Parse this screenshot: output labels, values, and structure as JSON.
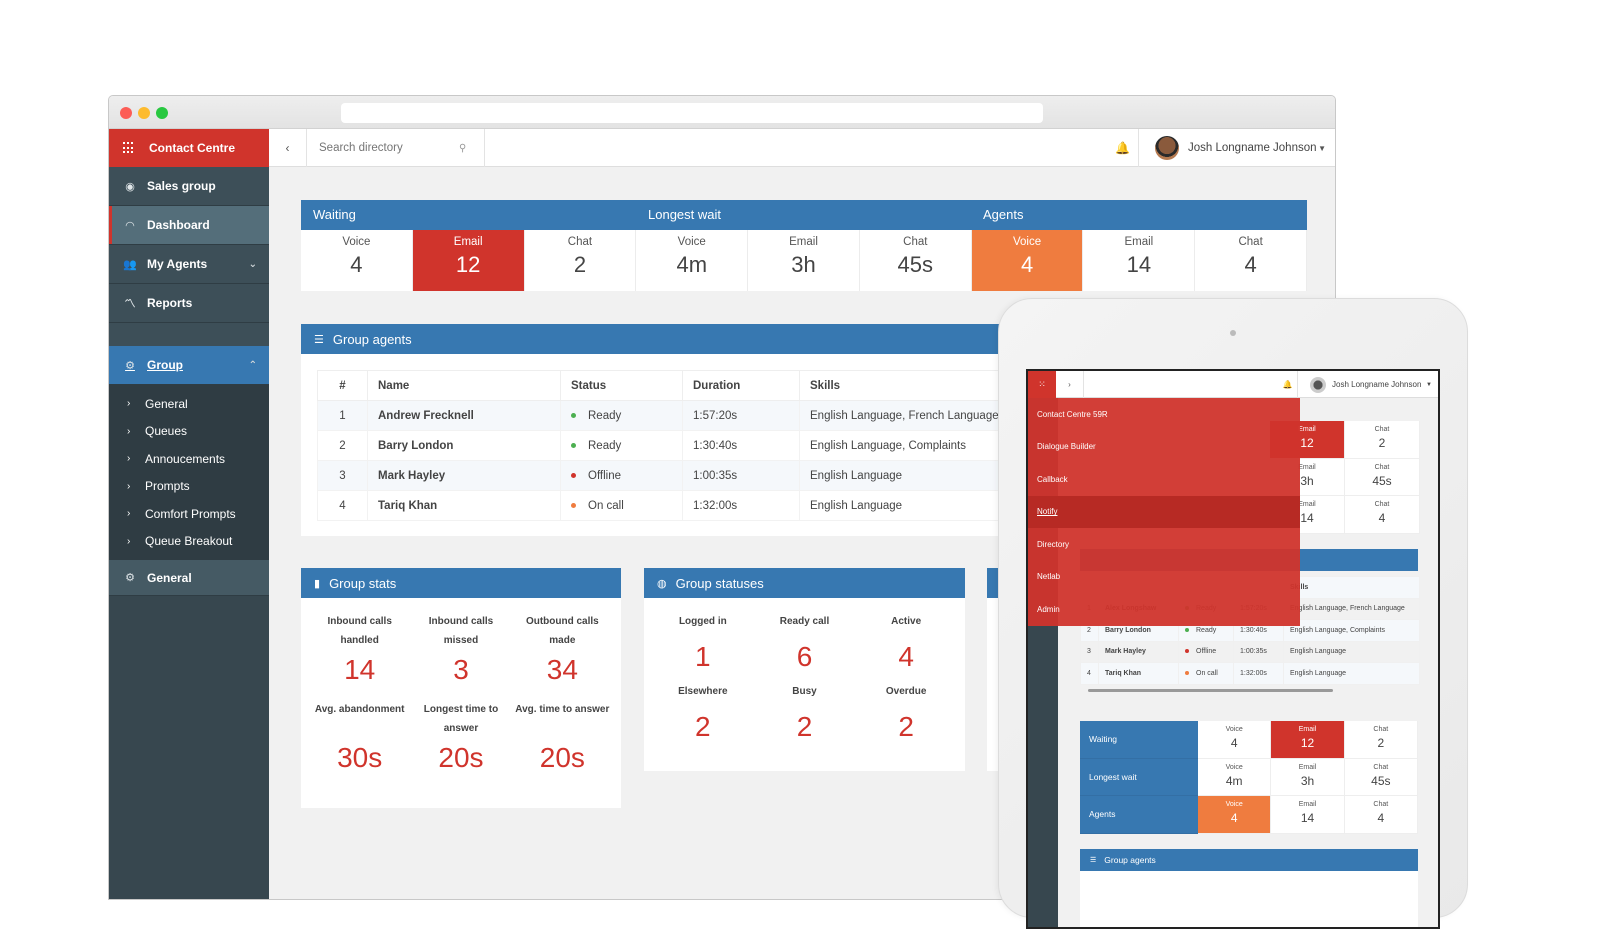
{
  "app": {
    "brand": "Contact Centre",
    "user_name": "Josh Longname Johnson"
  },
  "search": {
    "placeholder": "Search directory"
  },
  "sidebar": {
    "items": [
      {
        "label": "Sales group",
        "icon": "eye-icon"
      },
      {
        "label": "Dashboard",
        "icon": "gauge-icon",
        "active": true
      },
      {
        "label": "My Agents",
        "icon": "users-icon"
      },
      {
        "label": "Reports",
        "icon": "chart-line-icon"
      }
    ],
    "group": {
      "label": "Group",
      "icon": "gear-icon"
    },
    "sub_items": [
      "General",
      "Queues",
      "Annoucements",
      "Prompts",
      "Comfort Prompts",
      "Queue Breakout"
    ],
    "general": {
      "label": "General",
      "icon": "gear-icon"
    }
  },
  "summary": {
    "headers": [
      "Waiting",
      "Longest wait",
      "Agents"
    ],
    "cells": [
      {
        "label": "Voice",
        "value": "4",
        "highlight": ""
      },
      {
        "label": "Email",
        "value": "12",
        "highlight": "red"
      },
      {
        "label": "Chat",
        "value": "2",
        "highlight": ""
      },
      {
        "label": "Voice",
        "value": "4m",
        "highlight": ""
      },
      {
        "label": "Email",
        "value": "3h",
        "highlight": ""
      },
      {
        "label": "Chat",
        "value": "45s",
        "highlight": ""
      },
      {
        "label": "Voice",
        "value": "4",
        "highlight": "orange"
      },
      {
        "label": "Email",
        "value": "14",
        "highlight": ""
      },
      {
        "label": "Chat",
        "value": "4",
        "highlight": ""
      }
    ],
    "colors": {
      "red": "#d0342c",
      "orange": "#ef7c3f",
      "blue": "#3778b1"
    }
  },
  "group_agents": {
    "title": "Group agents",
    "columns": [
      "#",
      "Name",
      "Status",
      "Duration",
      "Skills"
    ],
    "rows": [
      {
        "num": "1",
        "name": "Andrew Frecknell",
        "status": "Ready",
        "status_color": "#4caf50",
        "duration": "1:57:20s",
        "skills": "English Language, French Language"
      },
      {
        "num": "2",
        "name": "Barry London",
        "status": "Ready",
        "status_color": "#4caf50",
        "duration": "1:30:40s",
        "skills": "English Language, Complaints"
      },
      {
        "num": "3",
        "name": "Mark Hayley",
        "status": "Offline",
        "status_color": "#d0342c",
        "duration": "1:00:35s",
        "skills": "English Language"
      },
      {
        "num": "4",
        "name": "Tariq Khan",
        "status": "On call",
        "status_color": "#ef7c3f",
        "duration": "1:32:00s",
        "skills": "English Language"
      }
    ]
  },
  "group_stats": {
    "title": "Group stats",
    "items": [
      {
        "label": "Inbound calls handled",
        "value": "14"
      },
      {
        "label": "Inbound calls missed",
        "value": "3"
      },
      {
        "label": "Outbound calls made",
        "value": "34"
      },
      {
        "label": "Avg. abandonment",
        "value": "30s"
      },
      {
        "label": "Longest time to answer",
        "value": "20s"
      },
      {
        "label": "Avg. time to answer",
        "value": "20s"
      }
    ]
  },
  "group_statuses": {
    "title": "Group statuses",
    "items": [
      {
        "label": "Logged in",
        "value": "1"
      },
      {
        "label": "Ready call",
        "value": "6"
      },
      {
        "label": "Active",
        "value": "4"
      },
      {
        "label": "Elsewhere",
        "value": "2"
      },
      {
        "label": "Busy",
        "value": "2"
      },
      {
        "label": "Overdue",
        "value": "2"
      }
    ]
  },
  "tablet": {
    "user_name": "Josh Longname Johnson",
    "menu": [
      {
        "label": "Contact Centre 59R",
        "active": false
      },
      {
        "label": "Dialogue Builder",
        "active": false
      },
      {
        "label": "Callback",
        "active": false
      },
      {
        "label": "Notify",
        "active": true
      },
      {
        "label": "Directory",
        "active": false
      },
      {
        "label": "Netlab",
        "active": false
      },
      {
        "label": "Admin",
        "active": false
      }
    ],
    "top_cells": [
      [
        {
          "label": "Email",
          "value": "12",
          "highlight": "red"
        },
        {
          "label": "Chat",
          "value": "2"
        }
      ],
      [
        {
          "label": "Email",
          "value": "3h"
        },
        {
          "label": "Chat",
          "value": "45s"
        }
      ],
      [
        {
          "label": "Email",
          "value": "14"
        },
        {
          "label": "Chat",
          "value": "4"
        }
      ]
    ],
    "skills_header": "Skills",
    "table_rows": [
      {
        "num": "1",
        "name": "Alex Longshaw",
        "status": "Ready",
        "status_color": "#4caf50",
        "duration": "1:57:20s",
        "skills": "English Language, French Language"
      },
      {
        "num": "2",
        "name": "Barry London",
        "status": "Ready",
        "status_color": "#4caf50",
        "duration": "1:30:40s",
        "skills": "English Language, Complaints"
      },
      {
        "num": "3",
        "name": "Mark Hayley",
        "status": "Offline",
        "status_color": "#d0342c",
        "duration": "1:00:35s",
        "skills": "English Language"
      },
      {
        "num": "4",
        "name": "Tariq Khan",
        "status": "On call",
        "status_color": "#ef7c3f",
        "duration": "1:32:00s",
        "skills": "English Language"
      }
    ],
    "waiting_rows": [
      {
        "label": "Waiting",
        "cells": [
          {
            "label": "Voice",
            "value": "4"
          },
          {
            "label": "Email",
            "value": "12",
            "highlight": "red"
          },
          {
            "label": "Chat",
            "value": "2"
          }
        ]
      },
      {
        "label": "Longest wait",
        "cells": [
          {
            "label": "Voice",
            "value": "4m"
          },
          {
            "label": "Email",
            "value": "3h"
          },
          {
            "label": "Chat",
            "value": "45s"
          }
        ]
      },
      {
        "label": "Agents",
        "cells": [
          {
            "label": "Voice",
            "value": "4",
            "highlight": "orange"
          },
          {
            "label": "Email",
            "value": "14"
          },
          {
            "label": "Chat",
            "value": "4"
          }
        ]
      }
    ],
    "group_agents_title": "Group agents"
  }
}
